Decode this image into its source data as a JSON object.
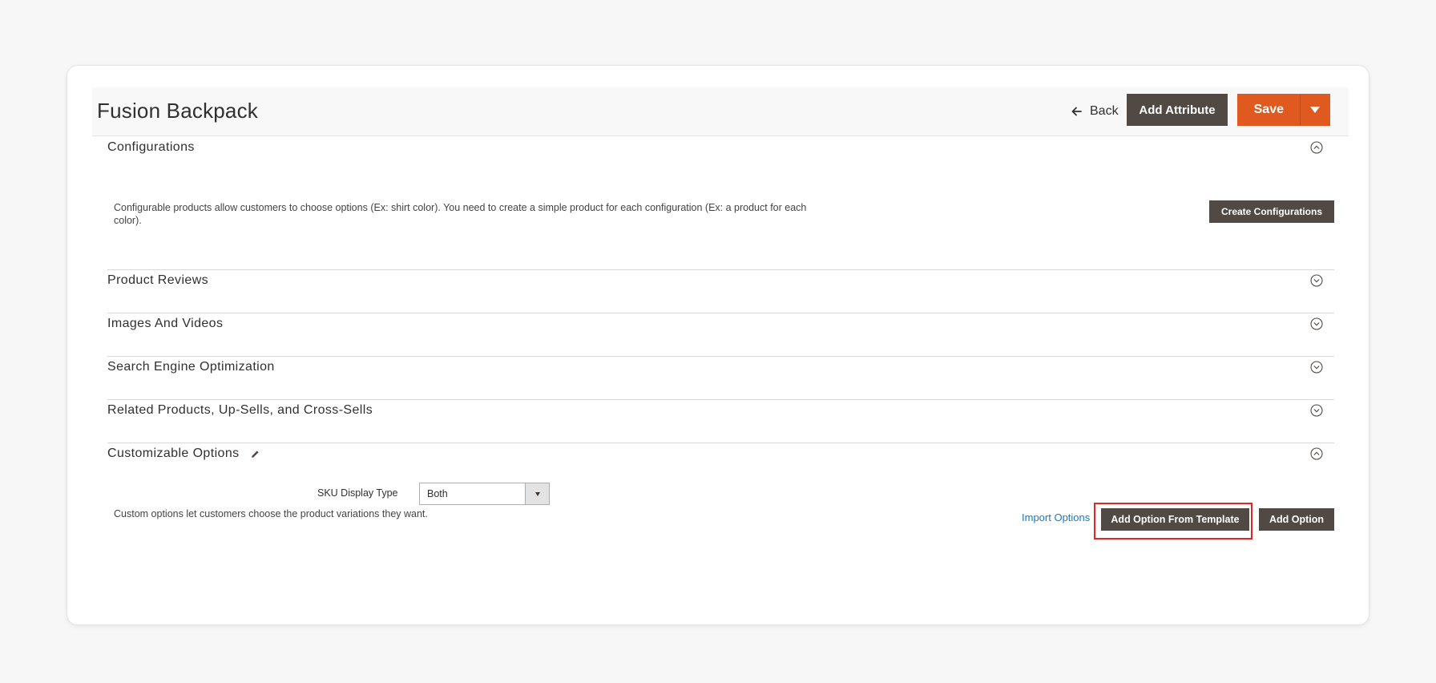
{
  "header": {
    "title": "Fusion Backpack",
    "back_label": "Back",
    "add_attribute_label": "Add Attribute",
    "save_label": "Save"
  },
  "sections": [
    {
      "title": "Configurations",
      "expanded": true,
      "description": "Configurable products allow customers to choose options (Ex: shirt color). You need to create a simple product for each configuration (Ex: a product for each color).",
      "action_label": "Create Configurations"
    },
    {
      "title": "Product Reviews",
      "expanded": false
    },
    {
      "title": "Images And Videos",
      "expanded": false
    },
    {
      "title": "Search Engine Optimization",
      "expanded": false
    },
    {
      "title": "Related Products, Up-Sells, and Cross-Sells",
      "expanded": false
    },
    {
      "title": "Customizable Options",
      "expanded": true,
      "description": "Custom options let customers choose the product variations they want.",
      "import_label": "Import Options",
      "add_from_template_label": "Add Option From Template",
      "add_option_label": "Add Option",
      "sku_display_type_label": "SKU Display Type",
      "sku_display_type_value": "Both"
    }
  ],
  "colors": {
    "primary_dark": "#514943",
    "save_orange": "#e0591f",
    "link_blue": "#1979c3",
    "highlight_red": "#e22626"
  }
}
